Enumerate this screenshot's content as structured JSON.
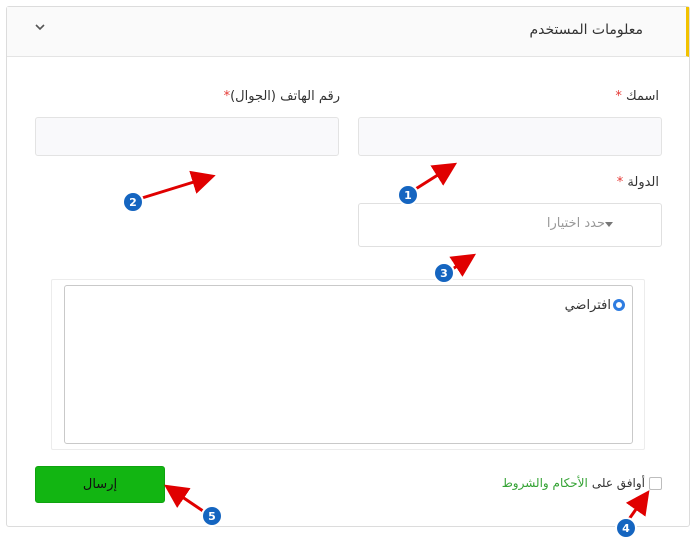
{
  "section": {
    "title": "معلومات المستخدم"
  },
  "fields": {
    "name_label": "اسمك",
    "phone_label": "رقم الهاتف (الجوال)",
    "country_label": "الدولة",
    "required_mark": "*",
    "country_select_placeholder": "حدد اختيارا"
  },
  "address_box": {
    "radio_label": "افتراضي"
  },
  "terms": {
    "prefix": "أوافق على",
    "link": "الأحكام والشروط"
  },
  "submit_label": "إرسال",
  "callouts": [
    "1",
    "2",
    "3",
    "4",
    "5"
  ],
  "colors": {
    "accent_yellow": "#f2c200",
    "submit_green": "#12b512",
    "link_green": "#35a335",
    "required_red": "#e53935",
    "radio_blue": "#2f7de1",
    "callout_blue": "#1565c0",
    "arrow_red": "#e00000"
  },
  "icons": [
    "chevron-down-icon",
    "caret-down-icon"
  ]
}
